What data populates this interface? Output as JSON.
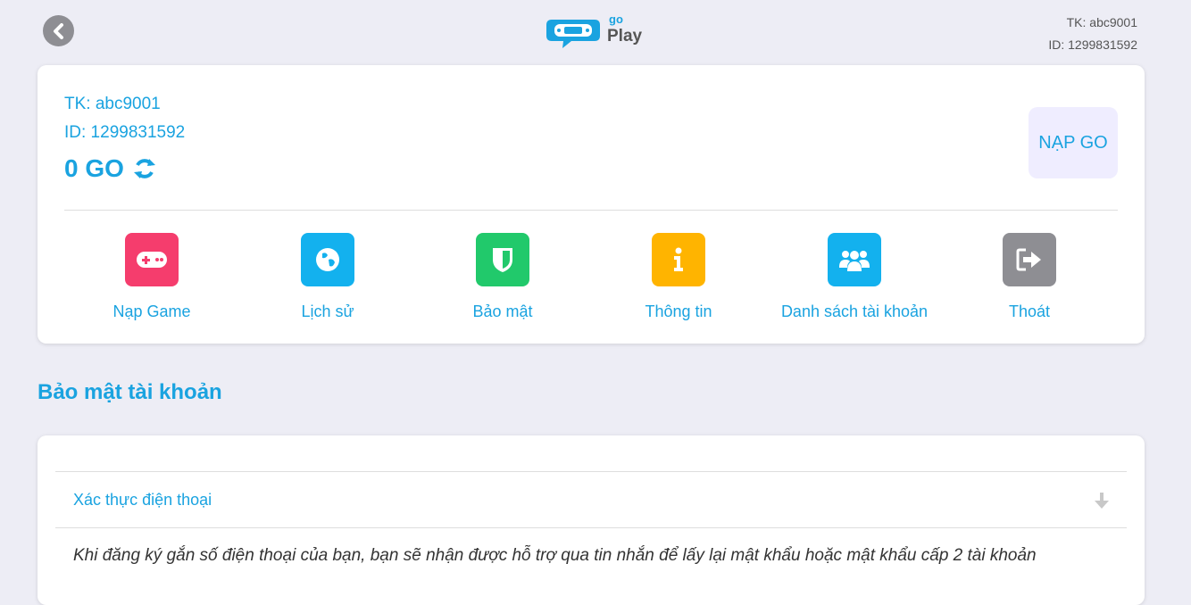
{
  "header": {
    "logo_small_text": "go",
    "logo_text": "Play",
    "account_label": "TK: abc9001",
    "id_label": "ID: 1299831592"
  },
  "account": {
    "tk": "TK: abc9001",
    "id": "ID: 1299831592",
    "balance": "0 GO",
    "topup_label": "NẠP GO"
  },
  "menu": [
    {
      "label": "Nạp Game",
      "icon": "gamepad-icon",
      "color": "#f53d6d"
    },
    {
      "label": "Lịch sử",
      "icon": "globe-icon",
      "color": "#13b1ee"
    },
    {
      "label": "Bảo mật",
      "icon": "shield-icon",
      "color": "#21c96b"
    },
    {
      "label": "Thông tin",
      "icon": "info-icon",
      "color": "#ffb400"
    },
    {
      "label": "Danh sách tài khoản",
      "icon": "users-icon",
      "color": "#13b1ee"
    },
    {
      "label": "Thoát",
      "icon": "sign-out-icon",
      "color": "#8e8e93"
    }
  ],
  "section": {
    "title": "Bảo mật tài khoản"
  },
  "security": {
    "phone_title": "Xác thực điện thoại",
    "phone_desc": "Khi đăng ký gắn số điện thoại của bạn, bạn sẽ nhận được hỗ trợ qua tin nhắn để lấy lại mật khẩu hoặc mật khẩu cấp 2 tài khoản"
  },
  "colors": {
    "accent": "#1aa3e0",
    "background": "#ededf5",
    "topup_bg": "#efedff"
  }
}
